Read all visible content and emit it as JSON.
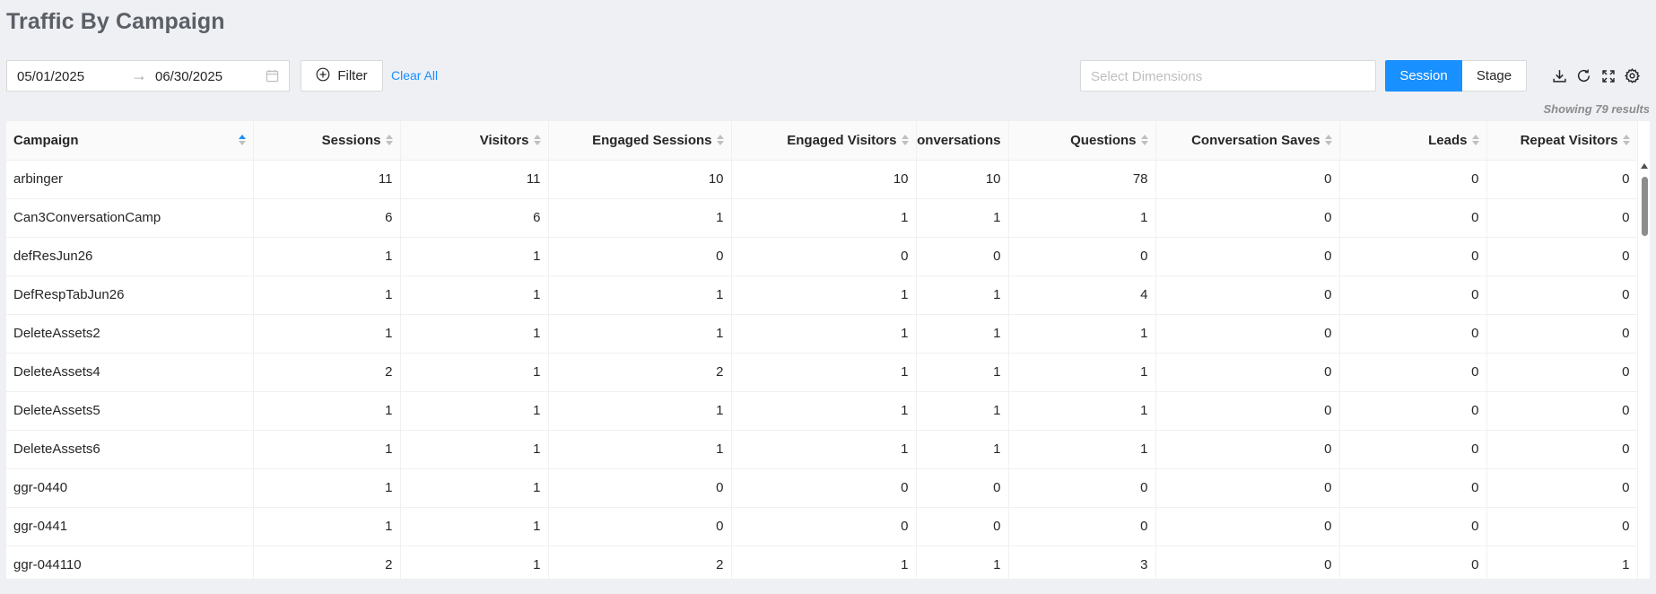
{
  "title": "Traffic By Campaign",
  "toolbar": {
    "date_start": "05/01/2025",
    "date_separator": "→",
    "date_end": "06/30/2025",
    "filter_label": "Filter",
    "clear_all_label": "Clear All",
    "dimensions_placeholder": "Select Dimensions",
    "session_label": "Session",
    "stage_label": "Stage",
    "icons": [
      "download-icon",
      "refresh-icon",
      "fullscreen-icon",
      "settings-icon"
    ]
  },
  "results_text": "Showing 79 results",
  "accent_color": "#1890ff",
  "table": {
    "columns": [
      "Campaign",
      "Sessions",
      "Visitors",
      "Engaged Sessions",
      "Engaged Visitors",
      "Conversations",
      "Questions",
      "Conversation Saves",
      "Leads",
      "Repeat Visitors"
    ],
    "rows": [
      [
        "arbinger",
        "11",
        "11",
        "10",
        "10",
        "10",
        "78",
        "0",
        "0",
        "0"
      ],
      [
        "Can3ConversationCamp",
        "6",
        "6",
        "1",
        "1",
        "1",
        "1",
        "0",
        "0",
        "0"
      ],
      [
        "defResJun26",
        "1",
        "1",
        "0",
        "0",
        "0",
        "0",
        "0",
        "0",
        "0"
      ],
      [
        "DefRespTabJun26",
        "1",
        "1",
        "1",
        "1",
        "1",
        "4",
        "0",
        "0",
        "0"
      ],
      [
        "DeleteAssets2",
        "1",
        "1",
        "1",
        "1",
        "1",
        "1",
        "0",
        "0",
        "0"
      ],
      [
        "DeleteAssets4",
        "2",
        "1",
        "2",
        "1",
        "1",
        "1",
        "0",
        "0",
        "0"
      ],
      [
        "DeleteAssets5",
        "1",
        "1",
        "1",
        "1",
        "1",
        "1",
        "0",
        "0",
        "0"
      ],
      [
        "DeleteAssets6",
        "1",
        "1",
        "1",
        "1",
        "1",
        "1",
        "0",
        "0",
        "0"
      ],
      [
        "ggr-0440",
        "1",
        "1",
        "0",
        "0",
        "0",
        "0",
        "0",
        "0",
        "0"
      ],
      [
        "ggr-0441",
        "1",
        "1",
        "0",
        "0",
        "0",
        "0",
        "0",
        "0",
        "0"
      ],
      [
        "ggr-044110",
        "2",
        "1",
        "2",
        "1",
        "1",
        "3",
        "0",
        "0",
        "1"
      ]
    ]
  }
}
